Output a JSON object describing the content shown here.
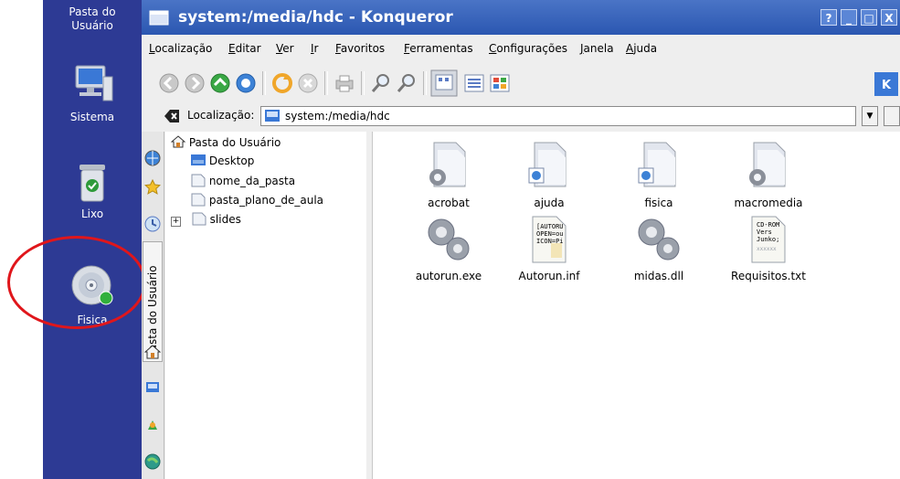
{
  "desktop": {
    "home_label": "Pasta do Usuário",
    "icons": [
      {
        "label": "Sistema",
        "icon": "computer-icon"
      },
      {
        "label": "Lixo",
        "icon": "trash-icon"
      },
      {
        "label": "Fisica",
        "icon": "cdrom-icon"
      }
    ]
  },
  "window": {
    "title": "system:/media/hdc - Konqueror",
    "buttons": {
      "help": "?",
      "minimize": "_",
      "maximize": "□",
      "close": "X"
    }
  },
  "menu": [
    "Localização",
    "Editar",
    "Ver",
    "Ir",
    "Favoritos",
    "Ferramentas",
    "Configurações",
    "Janela",
    "Ajuda"
  ],
  "location": {
    "label": "Localização:",
    "value": "system:/media/hdc"
  },
  "sidebar": {
    "tab_label": "Pasta do Usuário",
    "tree_root": "Pasta do Usuário",
    "tree_items": [
      "Desktop",
      "nome_da_pasta",
      "pasta_plano_de_aula",
      "slides"
    ]
  },
  "files": [
    {
      "name": "acrobat",
      "icon": "folder-icon"
    },
    {
      "name": "ajuda",
      "icon": "folder-html-icon"
    },
    {
      "name": "fisica",
      "icon": "folder-html-icon"
    },
    {
      "name": "macromedia",
      "icon": "folder-gear-icon"
    },
    {
      "name": "autorun.exe",
      "icon": "executable-icon"
    },
    {
      "name": "Autorun.inf",
      "icon": "text-file-icon"
    },
    {
      "name": "midas.dll",
      "icon": "library-icon"
    },
    {
      "name": "Requisitos.txt",
      "icon": "text-file-icon"
    }
  ],
  "file_previews": {
    "autorun_inf": [
      "[AUTORU",
      "OPEN=ou",
      "ICON=Pi"
    ],
    "requisitos_txt": [
      "CD-ROM",
      "Vers",
      "Junko;",
      "xxxxxx"
    ]
  },
  "colors": {
    "desktop_bg": "#2d3a94",
    "titlebar": "#2b57b1",
    "highlight_ring": "#e0161b"
  }
}
